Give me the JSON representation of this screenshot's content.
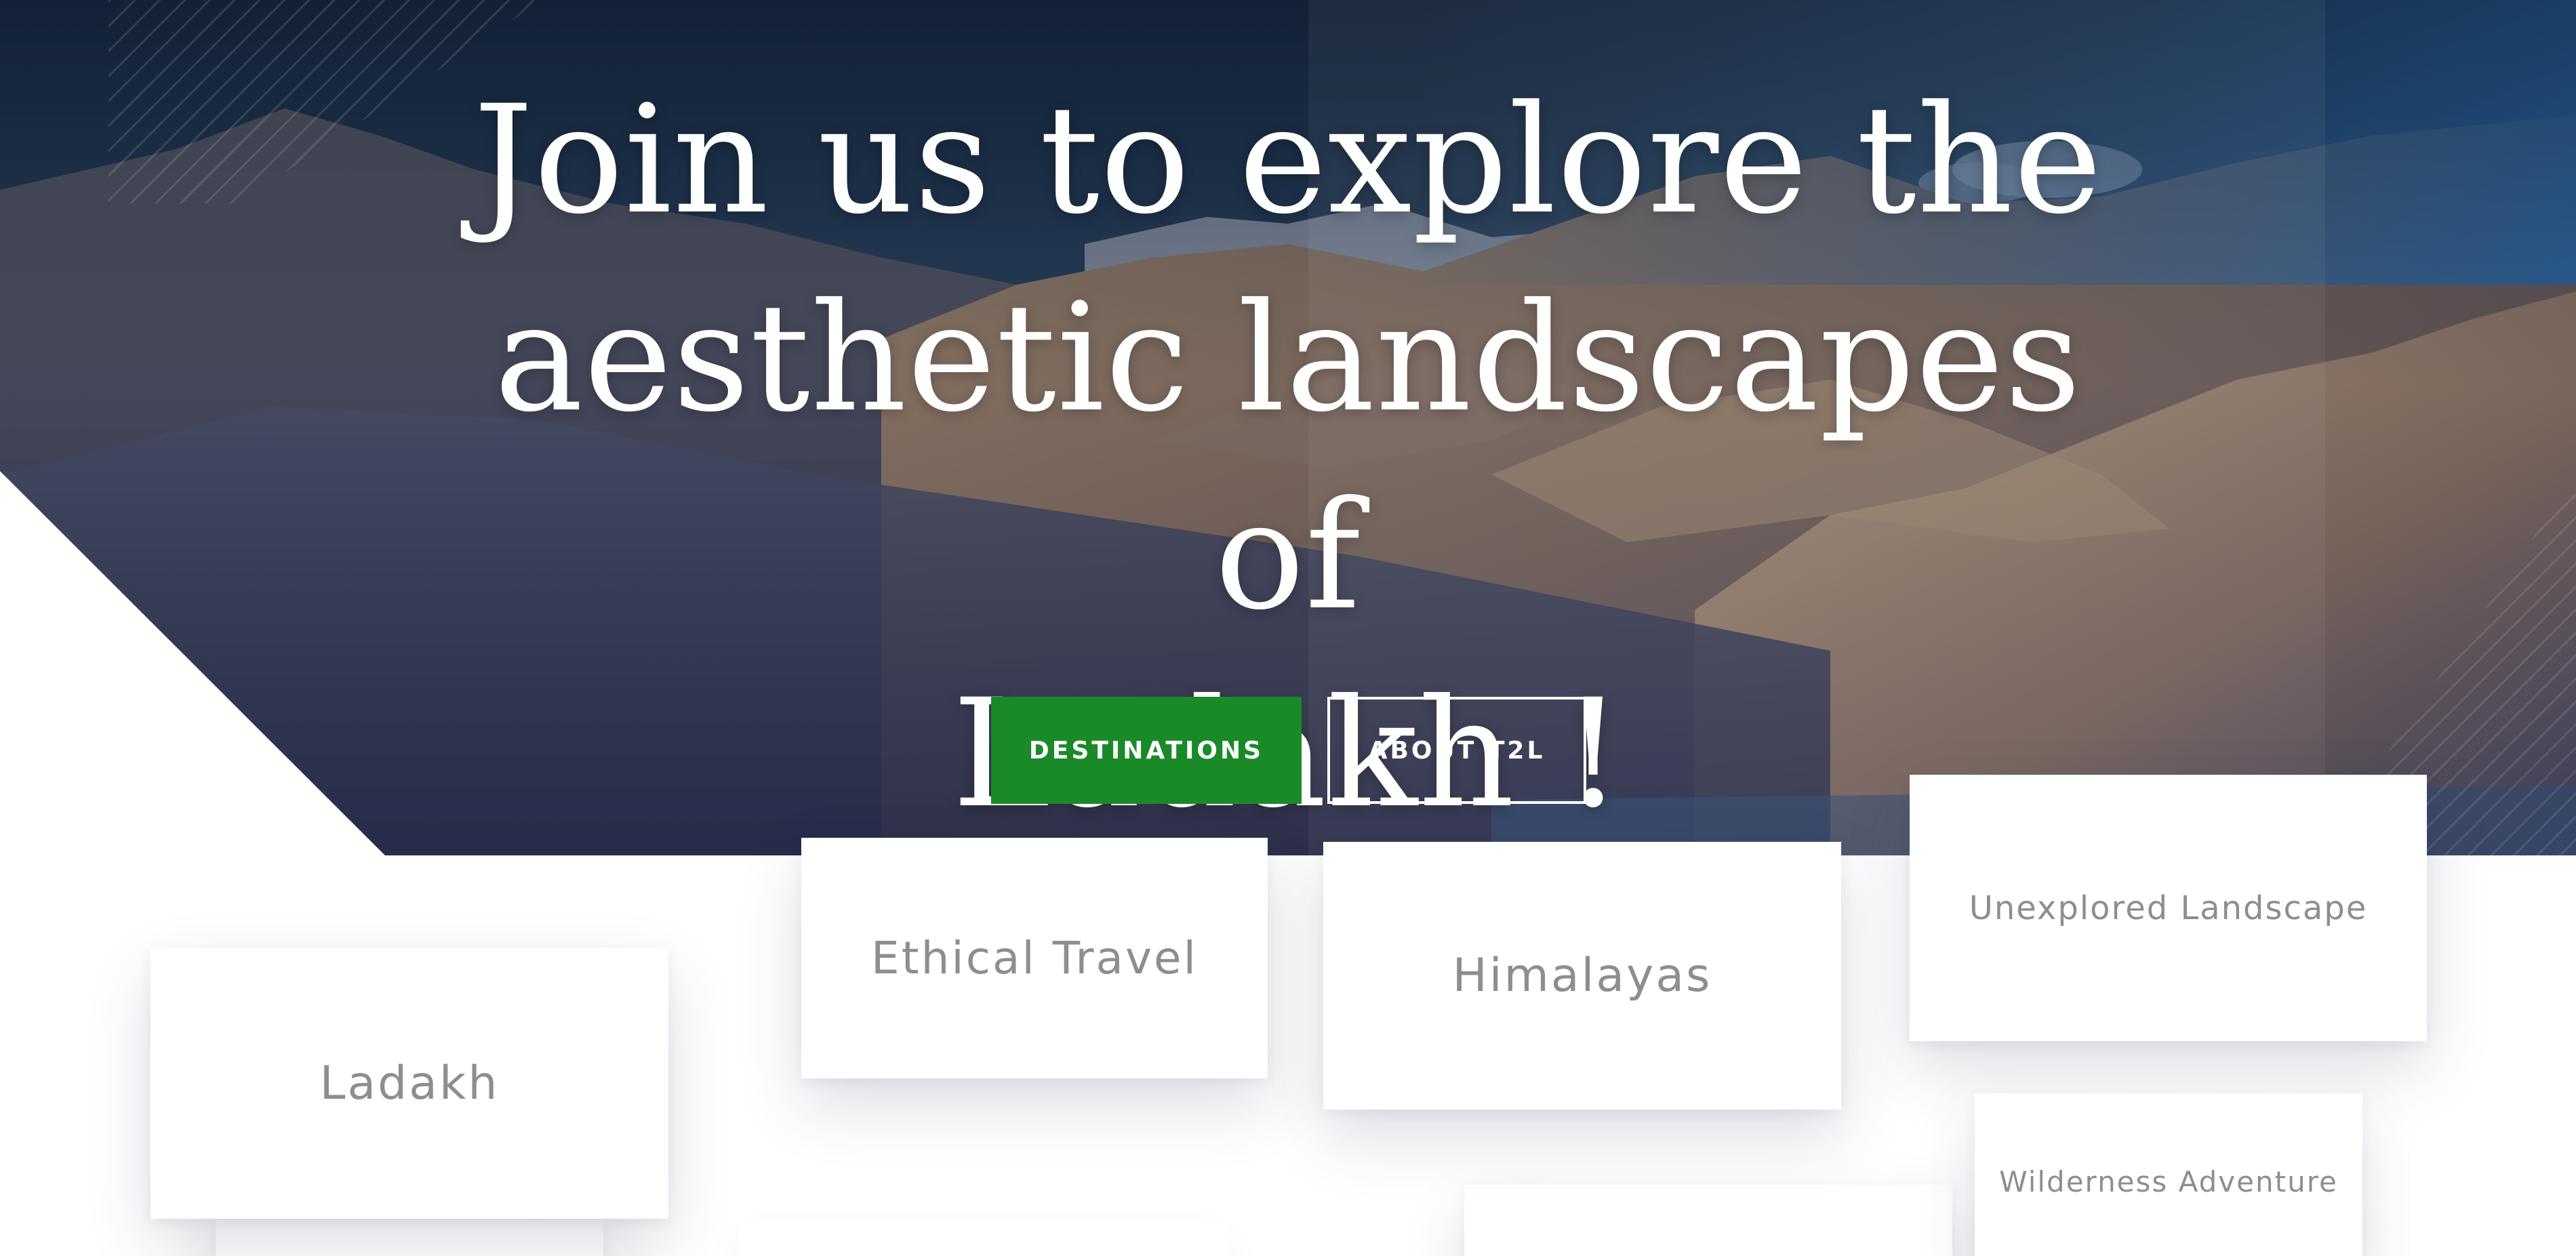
{
  "hero": {
    "title_line1": "Join us to explore the",
    "title_line2": "aesthetic landscapes of",
    "title_line3": "Ladakh !"
  },
  "buttons": {
    "destinations": "DESTINATIONS",
    "about": "ABOUT T2L"
  },
  "cards": {
    "ethical_travel": "Ethical Travel",
    "himalayas": "Himalayas",
    "unexplored_landscape": "Unexplored Landscape",
    "ladakh": "Ladakh",
    "wilderness_adventure": "Wilderness Adventure"
  },
  "colors": {
    "primary_green": "#1a8a28",
    "card_text": "#8e8e8e",
    "hero_dark": "#1a2e45"
  }
}
